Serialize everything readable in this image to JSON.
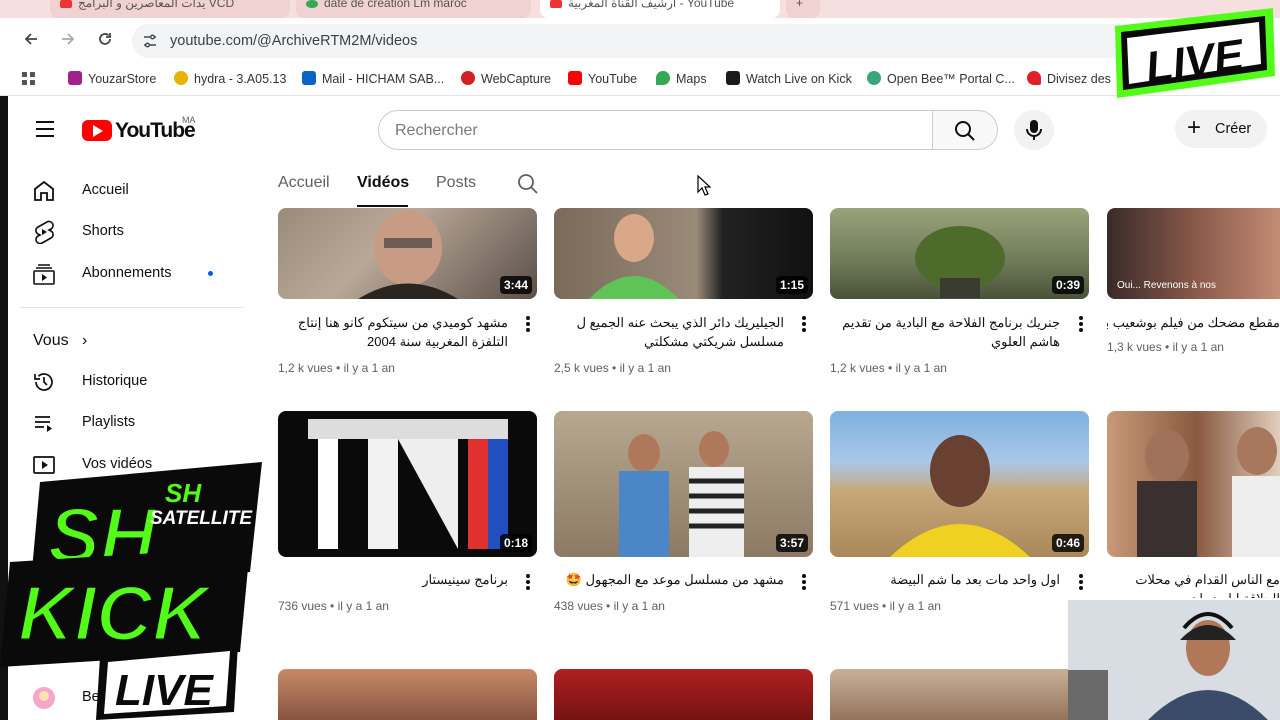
{
  "browser": {
    "tabs": [
      {
        "title": "يدات المعاصرين و البرامج VCD"
      },
      {
        "title": "date de création Lm maroc"
      },
      {
        "title": "أرشيف القناة المغربية - YouTube"
      }
    ],
    "url": "youtube.com/@ArchiveRTM2M/videos",
    "bookmarks": [
      "YouzarStore",
      "hydra - 3.A05.13",
      "Mail - HICHAM SAB...",
      "WebCapture",
      "YouTube",
      "Maps",
      "Watch Live on Kick",
      "Open Bee™ Portal C...",
      "Divisez des"
    ]
  },
  "header": {
    "logo_text": "YouTube",
    "country": "MA",
    "search_placeholder": "Rechercher",
    "create_label": "Créer"
  },
  "sidebar": {
    "items": [
      {
        "label": "Accueil",
        "icon": "home-icon"
      },
      {
        "label": "Shorts",
        "icon": "shorts-icon"
      },
      {
        "label": "Abonnements",
        "icon": "subscriptions-icon"
      }
    ],
    "you_label": "Vous",
    "you_items": [
      {
        "label": "Historique",
        "icon": "history-icon"
      },
      {
        "label": "Playlists",
        "icon": "playlist-icon"
      },
      {
        "label": "Vos vidéos",
        "icon": "your-videos-icon"
      }
    ],
    "subs_label": "Abonnements",
    "sub_channel": "Beb"
  },
  "channel_tabs": [
    "Accueil",
    "Vidéos",
    "Posts"
  ],
  "videos": [
    {
      "title": "مشهد كوميدي من سيتكوم كانو هنا إنتاج التلفزة المغربية سنة 2004",
      "views": "1,2 k vues",
      "age": "il y a 1 an",
      "duration": "3:44"
    },
    {
      "title": "الجيليريك دائر الذي يبحث عنه الجميع ل مسلسل شريكتي مشكلتي",
      "views": "2,5 k vues",
      "age": "il y a 1 an",
      "duration": "1:15"
    },
    {
      "title": "جنريك برنامج الفلاحة مع البادية من تقديم هاشم العلوي",
      "views": "1,2 k vues",
      "age": "il y a 1 an",
      "duration": "0:39"
    },
    {
      "title": "مقطع مضحك من فيلم بوشعيب بوسعود",
      "views": "1,3 k vues",
      "age": "il y a 1 an",
      "duration": ""
    },
    {
      "title": "برنامج سينيستار",
      "views": "736 vues",
      "age": "il y a 1 an",
      "duration": "0:18"
    },
    {
      "title": "مشهد من مسلسل موعد مع المجهول 🤩",
      "views": "438 vues",
      "age": "il y a 1 an",
      "duration": "3:57"
    },
    {
      "title": "اول واحد مات بعد ما شم البيضة",
      "views": "571 vues",
      "age": "il y a 1 an",
      "duration": "0:46"
    },
    {
      "title": "مع الناس القدام في محلات الحلاقة ايام زمان",
      "views": "",
      "age": "",
      "duration": ""
    }
  ],
  "overlay": {
    "live_text": "LIVE",
    "brand_sh": "SH",
    "brand_sh_small": "SH",
    "brand_satellite": "SATELLITE",
    "brand_kick": "KICK",
    "brand_live": "LIVE",
    "thumb_caption": "Oui... Revenons à nos"
  },
  "colors": {
    "youtube_red": "#ff0000",
    "kick_green": "#53fc18",
    "link_blue": "#065fd4"
  }
}
